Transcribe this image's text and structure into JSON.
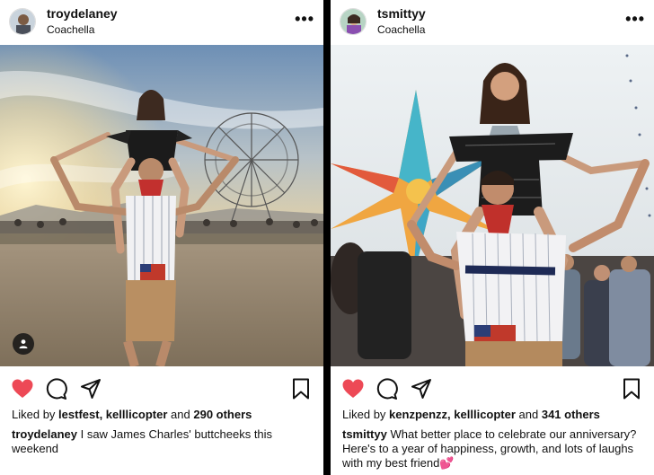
{
  "posts": [
    {
      "username": "troydelaney",
      "location": "Coachella",
      "more_label": "•••",
      "liked_prefix": "Liked by ",
      "liked_users": "lestfest, kelllicopter",
      "liked_connector": " and ",
      "liked_others": "290 others",
      "caption_user": "troydelaney",
      "caption_text": " I saw James Charles' buttcheeks this weekend",
      "icons": [
        "heart-filled",
        "comment",
        "share",
        "bookmark",
        "person-tag"
      ]
    },
    {
      "username": "tsmittyy",
      "location": "Coachella",
      "more_label": "•••",
      "liked_prefix": "Liked by ",
      "liked_users": "kenzpenzz, kelllicopter",
      "liked_connector": " and ",
      "liked_others": "341 others",
      "caption_user": "tsmittyy",
      "caption_text": " What better place to celebrate our anniversary? Here's to a year of happiness, growth, and lots of laughs with my best friend💕",
      "icons": [
        "heart-filled",
        "comment",
        "share",
        "bookmark"
      ]
    }
  ],
  "colors": {
    "like_red": "#ed4956",
    "divider": "#000000"
  }
}
